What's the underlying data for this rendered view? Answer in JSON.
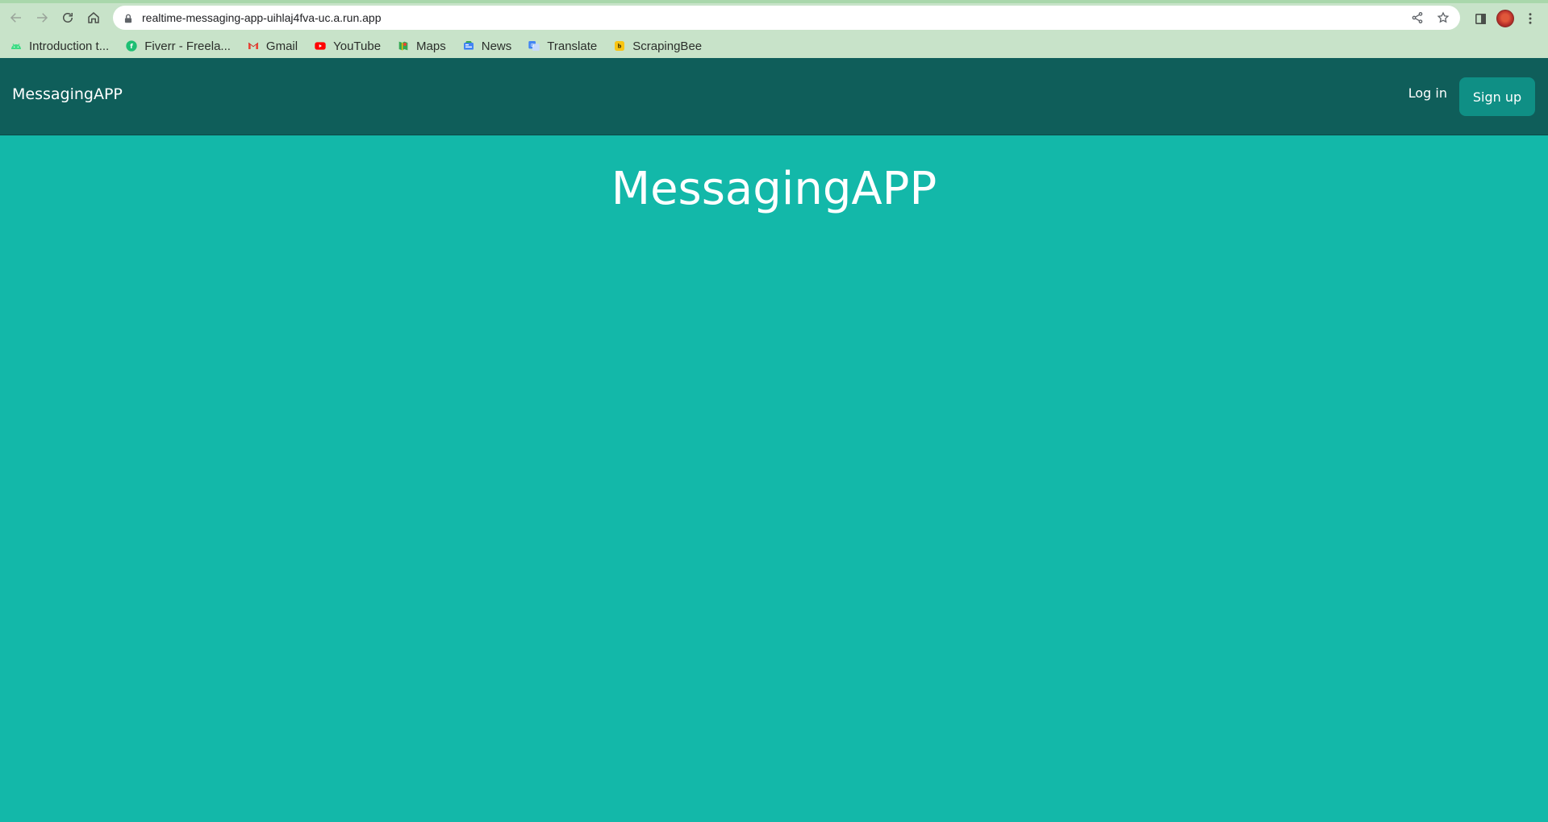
{
  "browser": {
    "url": "realtime-messaging-app-uihlaj4fva-uc.a.run.app",
    "bookmarks": [
      {
        "label": "Introduction t...",
        "icon": "android-icon"
      },
      {
        "label": "Fiverr - Freela...",
        "icon": "fiverr-icon"
      },
      {
        "label": "Gmail",
        "icon": "gmail-icon"
      },
      {
        "label": "YouTube",
        "icon": "youtube-icon"
      },
      {
        "label": "Maps",
        "icon": "maps-icon"
      },
      {
        "label": "News",
        "icon": "news-icon"
      },
      {
        "label": "Translate",
        "icon": "translate-icon"
      },
      {
        "label": "ScrapingBee",
        "icon": "scrapingbee-icon"
      }
    ]
  },
  "navbar": {
    "brand": "MessagingAPP",
    "login_label": "Log in",
    "signup_label": "Sign up"
  },
  "hero": {
    "title": "MessagingAPP"
  },
  "colors": {
    "background": "#13b8a9",
    "navbar": "#0f5e5a",
    "signup_button": "#0f8f85",
    "chrome": "#c8e3c9"
  }
}
